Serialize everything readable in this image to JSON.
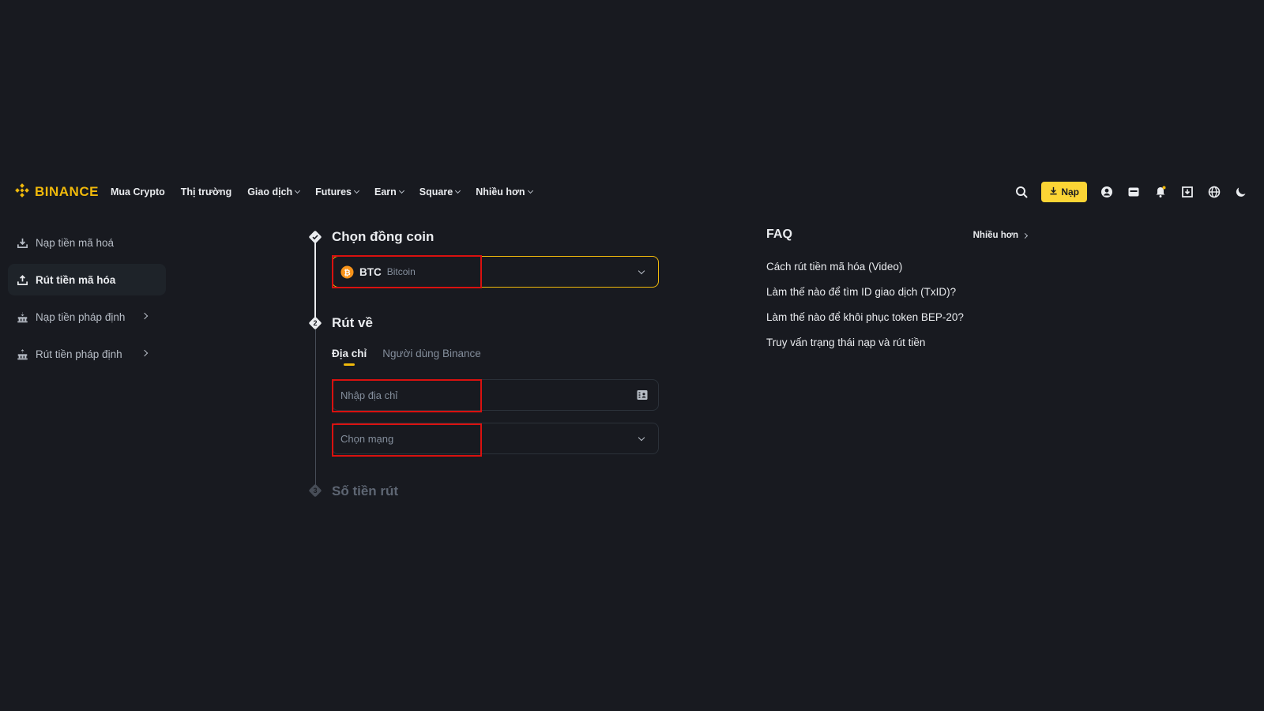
{
  "brand": {
    "name": "BINANCE",
    "color": "#f0b90b"
  },
  "nav": {
    "items": [
      {
        "label": "Mua Crypto",
        "dropdown": false
      },
      {
        "label": "Thị trường",
        "dropdown": false
      },
      {
        "label": "Giao dịch",
        "dropdown": true
      },
      {
        "label": "Futures",
        "dropdown": true
      },
      {
        "label": "Earn",
        "dropdown": true
      },
      {
        "label": "Square",
        "dropdown": true
      },
      {
        "label": "Nhiều hơn",
        "dropdown": true
      }
    ],
    "deposit_label": "Nạp",
    "icons": [
      "search-icon",
      "user-icon",
      "wallet-icon",
      "bell-icon",
      "download-app-icon",
      "globe-icon",
      "moon-icon"
    ]
  },
  "sidebar": {
    "items": [
      {
        "label": "Nạp tiền mã hoá",
        "icon": "download-icon",
        "active": false,
        "submenu": false
      },
      {
        "label": "Rút tiền mã hóa",
        "icon": "upload-icon",
        "active": true,
        "submenu": false
      },
      {
        "label": "Nạp tiền pháp định",
        "icon": "bank-icon",
        "active": false,
        "submenu": true
      },
      {
        "label": "Rút tiền pháp định",
        "icon": "bank-icon",
        "active": false,
        "submenu": true
      }
    ]
  },
  "steps": {
    "step1": {
      "title": "Chọn đồng coin"
    },
    "step2": {
      "title": "Rút về",
      "number": "2"
    },
    "step3": {
      "title": "Số tiền rút",
      "number": "3"
    }
  },
  "coin_select": {
    "symbol": "BTC",
    "name": "Bitcoin",
    "icon": "bitcoin-icon"
  },
  "withdraw_tabs": [
    {
      "label": "Địa chỉ",
      "active": true
    },
    {
      "label": "Người dùng Binance",
      "active": false
    }
  ],
  "address_field": {
    "placeholder": "Nhập địa chỉ"
  },
  "network_field": {
    "placeholder": "Chọn mạng"
  },
  "faq": {
    "title": "FAQ",
    "more_label": "Nhiều hơn",
    "links": [
      "Cách rút tiền mã hóa (Video)",
      "Làm thế nào để tìm ID giao dịch (TxID)?",
      "Làm thế nào để khôi phục token BEP-20?",
      "Truy vấn trạng thái nạp và rút tiền"
    ]
  },
  "colors": {
    "background": "#181a20",
    "accent": "#fcd535",
    "highlight": "#d9110f"
  }
}
